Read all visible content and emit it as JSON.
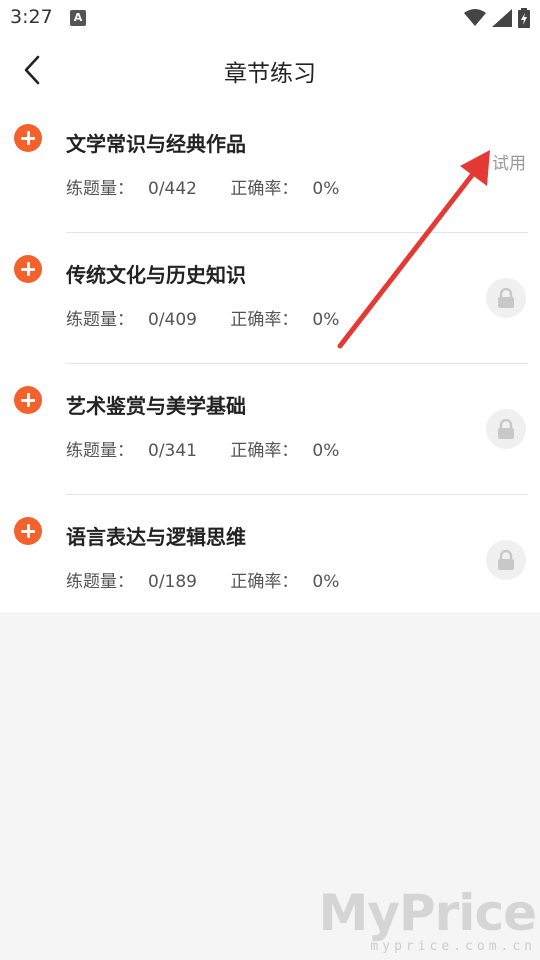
{
  "status": {
    "time": "3:27",
    "notification_icon": "A"
  },
  "header": {
    "title": "章节练习"
  },
  "chapters": [
    {
      "title": "文学常识与经典作品",
      "count_label": "练题量：",
      "count": "0/442",
      "accuracy_label": "正确率：",
      "accuracy": "0%",
      "action": "试用"
    },
    {
      "title": "传统文化与历史知识",
      "count_label": "练题量：",
      "count": "0/409",
      "accuracy_label": "正确率：",
      "accuracy": "0%",
      "action_icon": "lock-icon"
    },
    {
      "title": "艺术鉴赏与美学基础",
      "count_label": "练题量：",
      "count": "0/341",
      "accuracy_label": "正确率：",
      "accuracy": "0%",
      "action_icon": "lock-icon"
    },
    {
      "title": "语言表达与逻辑思维",
      "count_label": "练题量：",
      "count": "0/189",
      "accuracy_label": "正确率：",
      "accuracy": "0%",
      "action_icon": "lock-icon"
    }
  ],
  "colors": {
    "accent": "#f4612c",
    "arrow": "#e53935",
    "background": "#f5f5f5"
  },
  "watermark": {
    "main": "MyPrice",
    "sub": "myprice.com.cn"
  }
}
